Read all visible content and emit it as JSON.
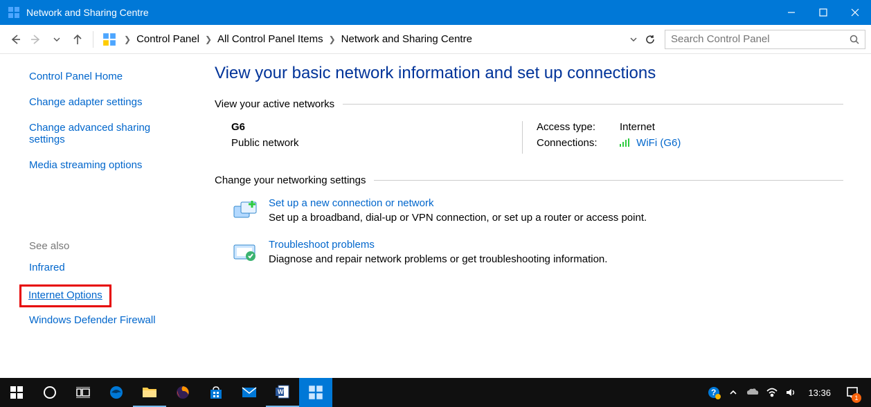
{
  "window": {
    "title": "Network and Sharing Centre"
  },
  "breadcrumb": [
    "Control Panel",
    "All Control Panel Items",
    "Network and Sharing Centre"
  ],
  "search": {
    "placeholder": "Search Control Panel"
  },
  "sidebar": {
    "home": "Control Panel Home",
    "links": [
      "Change adapter settings",
      "Change advanced sharing settings",
      "Media streaming options"
    ],
    "see_also_heading": "See also",
    "see_also": [
      "Infrared",
      "Internet Options",
      "Windows Defender Firewall"
    ]
  },
  "main": {
    "heading": "View your basic network information and set up connections",
    "active_networks_label": "View your active networks",
    "network": {
      "name": "G6",
      "type": "Public network",
      "access_label": "Access type:",
      "access_value": "Internet",
      "connections_label": "Connections:",
      "connections_value": "WiFi (G6)"
    },
    "change_settings_label": "Change your networking settings",
    "items": [
      {
        "title": "Set up a new connection or network",
        "desc": "Set up a broadband, dial-up or VPN connection, or set up a router or access point."
      },
      {
        "title": "Troubleshoot problems",
        "desc": "Diagnose and repair network problems or get troubleshooting information."
      }
    ]
  },
  "taskbar": {
    "clock": "13:36",
    "notif_count": "1"
  }
}
